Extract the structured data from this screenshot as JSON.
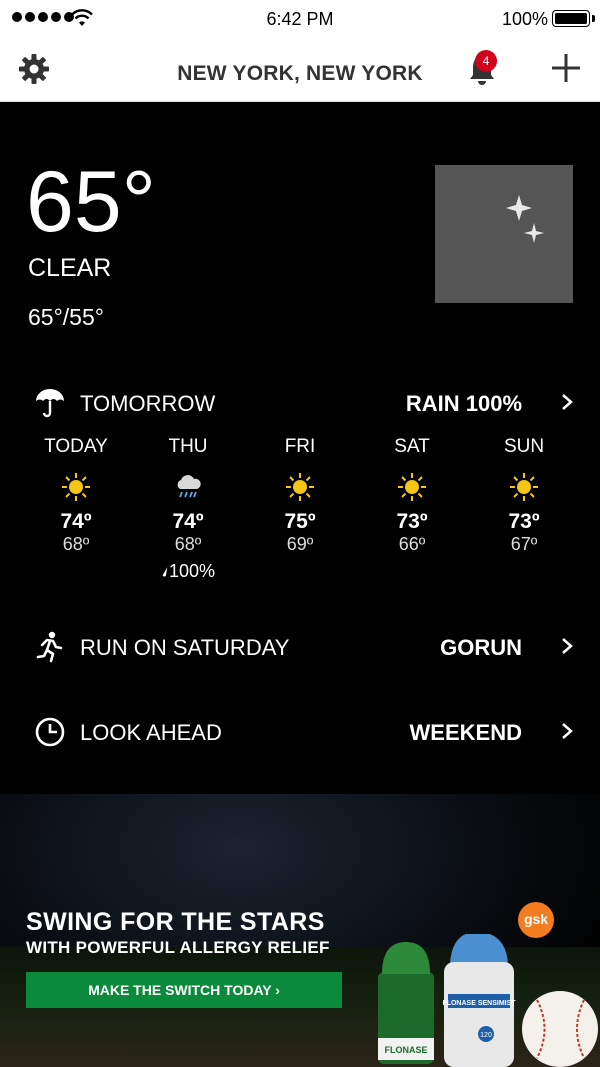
{
  "status_bar": {
    "time": "6:42 PM",
    "battery": "100%"
  },
  "nav": {
    "title": "NEW YORK, NEW YORK",
    "badge_count": "4",
    "icons": [
      "gear-icon",
      "bell-icon",
      "plus-icon"
    ]
  },
  "current": {
    "temperature": "65°",
    "condition": "CLEAR",
    "hi_lo": "65°/55°",
    "icon": "moon-stars-icon"
  },
  "rows": [
    {
      "label": "TOMORROW",
      "value": "RAIN 100%",
      "icon": "umbrella-icon"
    },
    {
      "label": "RUN ON SATURDAY",
      "value": "GORUN",
      "icon": "runner-icon"
    },
    {
      "label": "LOOK AHEAD",
      "value": "WEEKEND",
      "icon": "clock-icon"
    }
  ],
  "forecast": [
    {
      "day": "TODAY",
      "hi": "74º",
      "lo": "68º",
      "icon": "sun-icon",
      "precip": ""
    },
    {
      "day": "THU",
      "hi": "74º",
      "lo": "68º",
      "icon": "rain-cloud-icon",
      "precip": "100%"
    },
    {
      "day": "FRI",
      "hi": "75º",
      "lo": "69º",
      "icon": "sun-icon",
      "precip": ""
    },
    {
      "day": "SAT",
      "hi": "73º",
      "lo": "66º",
      "icon": "sun-icon",
      "precip": ""
    },
    {
      "day": "SUN",
      "hi": "73º",
      "lo": "67º",
      "icon": "sun-icon",
      "precip": ""
    }
  ],
  "ad": {
    "headline": "SWING FOR THE STARS",
    "subheadline": "WITH POWERFUL ALLERGY RELIEF",
    "cta": "MAKE THE SWITCH TODAY ›",
    "brand_logo": "gsk",
    "product_label": "FLONASE",
    "product_label_2": "FLONASE SENSIMIST",
    "product_count": "120"
  },
  "colors": {
    "accent_green": "#0a8a3a",
    "badge_red": "#d0021b",
    "sun_yellow": "#f5c518"
  }
}
